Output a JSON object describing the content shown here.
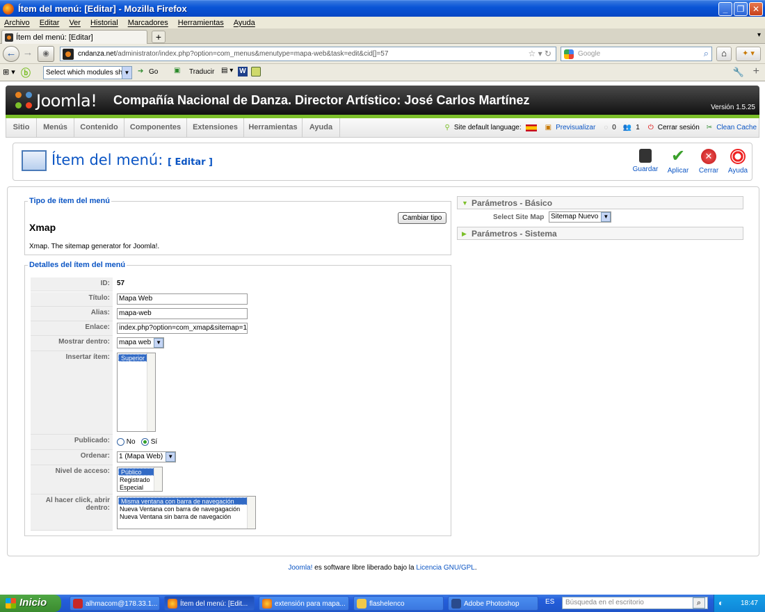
{
  "browser": {
    "window_title": "Ítem del menú: [Editar] - Mozilla Firefox",
    "menu": [
      "Archivo",
      "Editar",
      "Ver",
      "Historial",
      "Marcadores",
      "Herramientas",
      "Ayuda"
    ],
    "tab_title": "Ítem del menú: [Editar]",
    "new_tab": "+",
    "url_domain": "cndanza.net",
    "url_rest": "/administrator/index.php?option=com_menus&menutype=mapa-web&task=edit&cid[]=57",
    "search_placeholder": "Google",
    "addon_select": "Select which modules shou",
    "addon_go": "Go",
    "addon_translate": "Traducir"
  },
  "joomla": {
    "logo_text": "Joomla!",
    "site_name": "Compañía Nacional de Danza. Director Artístico: José Carlos Martínez",
    "version": "Versión 1.5.25",
    "menu": [
      "Sitio",
      "Menús",
      "Contenido",
      "Componentes",
      "Extensiones",
      "Herramientas",
      "Ayuda"
    ],
    "status": {
      "language_label": "Site default language:",
      "preview": "Previsualizar",
      "messages": "0",
      "users": "1",
      "logout": "Cerrar sesión",
      "clean_cache": "Clean Cache"
    }
  },
  "page": {
    "title": "Ítem del menú:",
    "title_sub": "[ Editar ]",
    "toolbar": {
      "save": "Guardar",
      "apply": "Aplicar",
      "close": "Cerrar",
      "help": "Ayuda"
    }
  },
  "type_section": {
    "legend": "Tipo de ítem del menú",
    "change_button": "Cambiar tipo",
    "name": "Xmap",
    "description": "Xmap. The sitemap generator for Joomla!."
  },
  "details": {
    "legend": "Detalles del ítem del menú",
    "id_label": "ID:",
    "id_value": "57",
    "title_label": "Título:",
    "title_value": "Mapa Web",
    "alias_label": "Alias:",
    "alias_value": "mapa-web",
    "link_label": "Enlace:",
    "link_value": "index.php?option=com_xmap&sitemap=1",
    "show_in_label": "Mostrar dentro:",
    "show_in_value": "mapa web",
    "insert_label": "Insertar ítem:",
    "insert_options": [
      "Superior"
    ],
    "published_label": "Publicado:",
    "published_no": "No",
    "published_yes": "Sí",
    "order_label": "Ordenar:",
    "order_value": "1 (Mapa Web)",
    "access_label": "Nivel de acceso:",
    "access_options": [
      "Público",
      "Registrado",
      "Especial"
    ],
    "click_label": "Al hacer click, abrir dentro:",
    "click_options": [
      "Misma ventana con barra de navegación",
      "Nueva Ventana con barra de navegagación",
      "Nueva Ventana sin barra de navegación"
    ]
  },
  "params": {
    "basic_header": "Parámetros - Básico",
    "sitemap_label": "Select Site Map",
    "sitemap_value": "Sitemap Nuevo",
    "system_header": "Parámetros - Sistema"
  },
  "footer": {
    "link1": "Joomla!",
    "text": " es software libre liberado bajo la ",
    "link2": "Licencia GNU/GPL",
    "end": "."
  },
  "taskbar": {
    "start": "Inicio",
    "items": [
      "alhmacom@178.33.1...",
      "Ítem del menú: [Edit...",
      "extensión para mapa...",
      "flashelenco",
      "Adobe Photoshop"
    ],
    "lang": "ES",
    "search_placeholder": "Búsqueda en el escritorio",
    "time": "18:47"
  }
}
